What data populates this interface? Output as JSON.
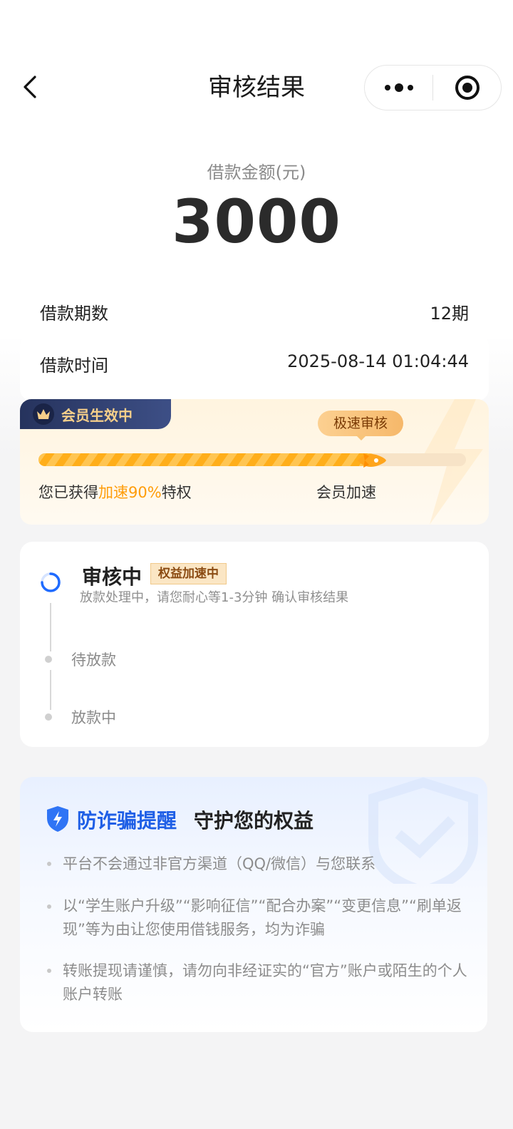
{
  "nav": {
    "title": "审核结果"
  },
  "loan": {
    "amount_label": "借款金额(元)",
    "amount": "3000",
    "periods_label": "借款期数",
    "periods_value": "12期",
    "time_label": "借款时间",
    "time_value": "2025-08-14 01:04:44"
  },
  "member": {
    "tag": "会员生效中",
    "bubble": "极速审核",
    "progress": 0.79,
    "left_prefix": "您已获得",
    "left_highlight": "加速90%",
    "left_suffix": "特权",
    "right_label": "会员加速"
  },
  "review": {
    "status_title": "审核中",
    "badge": "权益加速中",
    "description": "放款处理中，请您耐心等1-3分钟 确认审核结果",
    "steps": [
      "待放款",
      "放款中"
    ]
  },
  "fraud": {
    "title_highlight": "防诈骗提醒",
    "title_rest": "守护您的权益",
    "tips": [
      "平台不会通过非官方渠道（QQ/微信）与您联系",
      "以“学生账户升级”“影响征信”“配合办案”“变更信息”“刷单返现”等为由让您使用借钱服务，均为诈骗",
      "转账提现请谨慎，请勿向非经证实的“官方”账户或陌生的个人账户转账"
    ]
  },
  "colors": {
    "accent_blue": "#1f5fe6",
    "accent_orange": "#ff9d0a",
    "member_navy": "#26335d"
  },
  "icons": [
    "back-arrow-icon",
    "more-dots-icon",
    "target-icon",
    "crown-icon",
    "rocket-icon",
    "spinner-icon",
    "shield-icon"
  ]
}
